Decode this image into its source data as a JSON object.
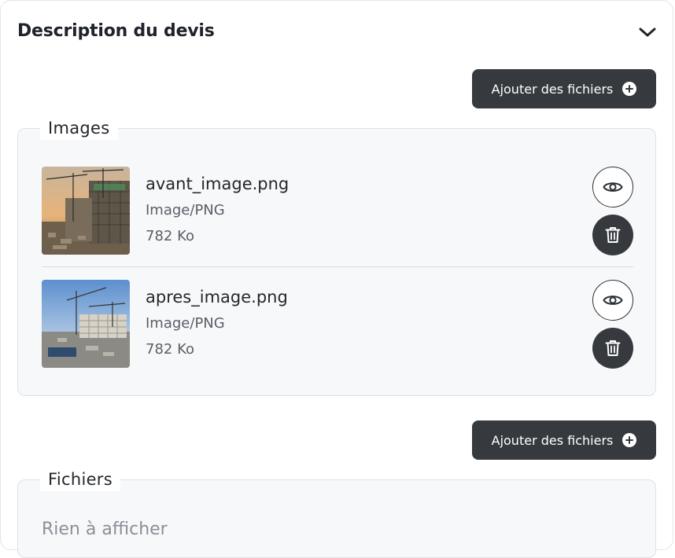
{
  "header": {
    "title": "Description du devis",
    "toggle_icon": "chevron-down-icon"
  },
  "add_button": {
    "label": "Ajouter des fichiers",
    "icon": "plus-circle-icon"
  },
  "images_section": {
    "legend": "Images",
    "files": [
      {
        "name": "avant_image.png",
        "type": "Image/PNG",
        "size": "782 Ko"
      },
      {
        "name": "apres_image.png",
        "type": "Image/PNG",
        "size": "782 Ko"
      }
    ]
  },
  "files_section": {
    "legend": "Fichiers",
    "empty_message": "Rien à afficher"
  },
  "colors": {
    "button_bg": "#363a3e",
    "section_bg": "#f7f8fa"
  }
}
